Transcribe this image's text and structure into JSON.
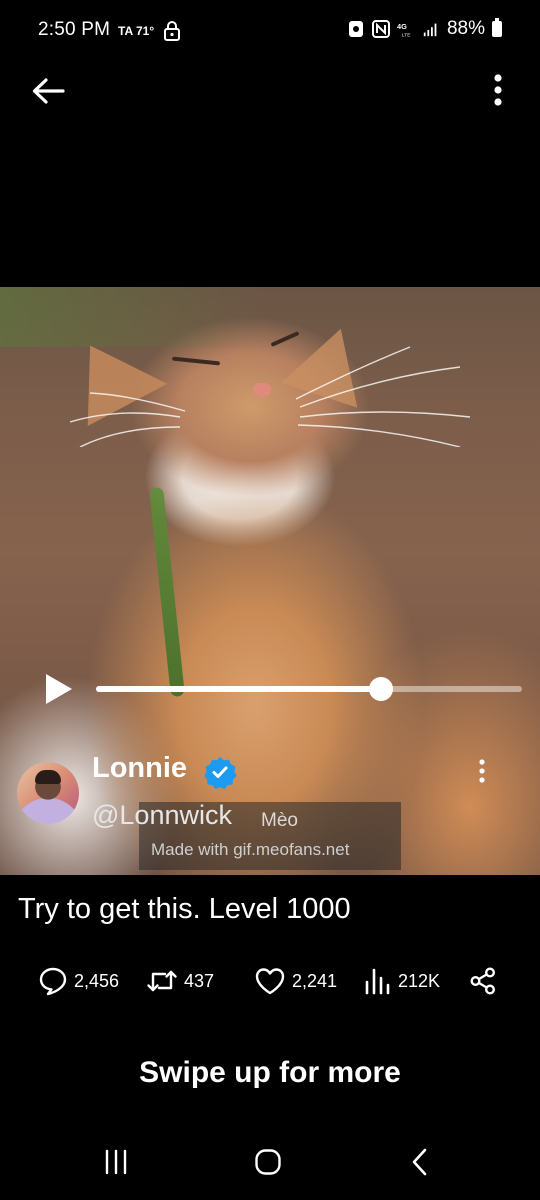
{
  "status_bar": {
    "time": "2:50 PM",
    "extra": "TA 71°",
    "battery": "88%"
  },
  "post": {
    "author_name": "Lonnie",
    "author_handle": "@Lonnwick",
    "text": "Try to get this. Level 1000",
    "watermark_brand": "Mèo",
    "watermark_made": "Made with gif.meofans.net",
    "video_progress": 0.67
  },
  "actions": {
    "replies": "2,456",
    "reposts": "437",
    "likes": "2,241",
    "views": "212K"
  },
  "footer": {
    "swipe_label": "Swipe up for more"
  },
  "colors": {
    "background": "#000000",
    "verified": "#1d9bf0",
    "text": "#ffffff"
  },
  "icons": [
    "back-arrow-icon",
    "more-vert-icon",
    "play-icon",
    "verified-badge-icon",
    "reply-icon",
    "repost-icon",
    "like-icon",
    "views-icon",
    "share-icon",
    "recents-icon",
    "home-icon",
    "back-icon"
  ]
}
